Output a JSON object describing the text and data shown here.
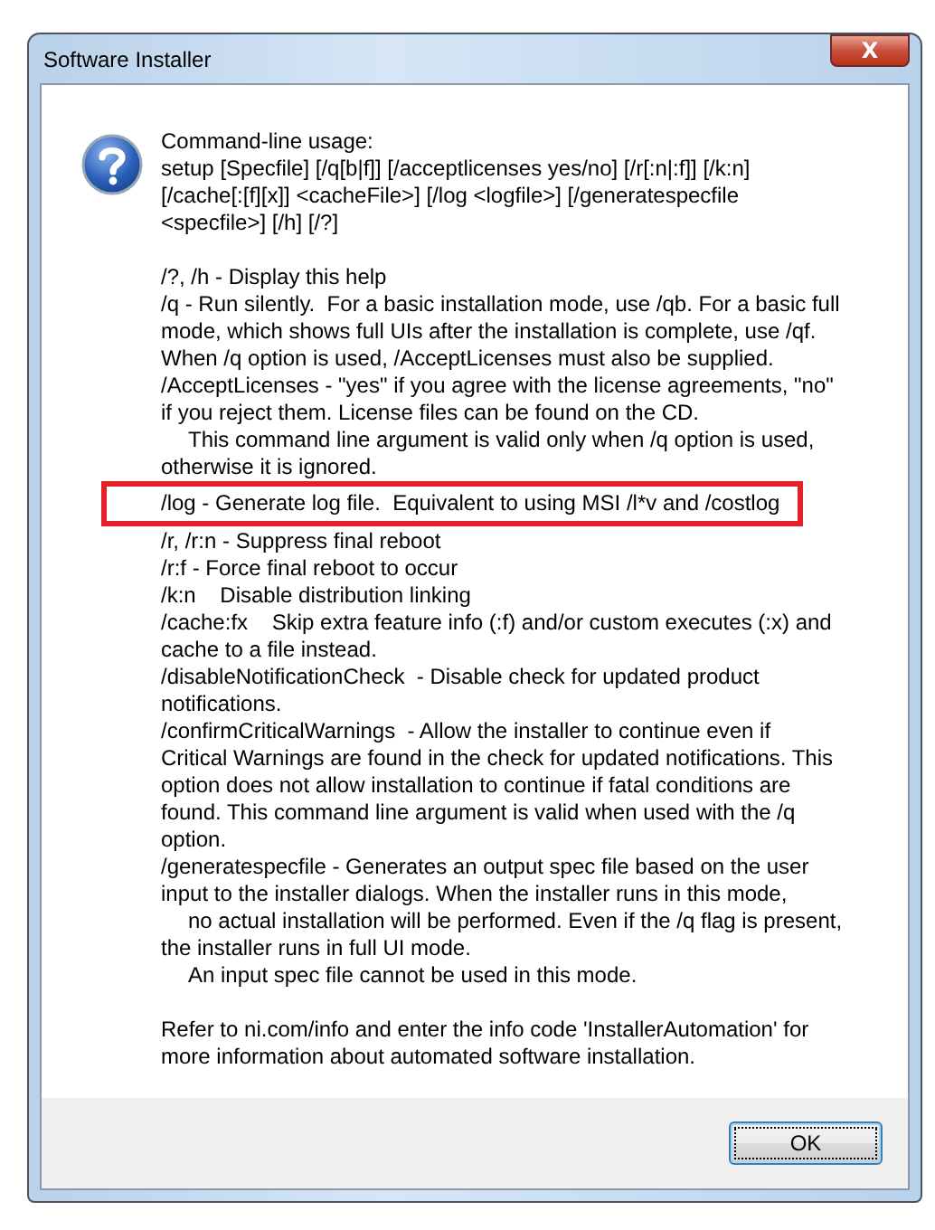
{
  "window": {
    "title": "Software Installer",
    "close_label": "X"
  },
  "message": {
    "paragraphs": [
      [
        {
          "text": "Command-line usage:",
          "indent": false
        },
        {
          "text": "setup [Specfile] [/q[b|f]] [/acceptlicenses yes/no] [/r[:n|:f]] [/k:n]",
          "indent": false
        },
        {
          "text": "[/cache[:[f][x]] <cacheFile>] [/log <logfile>] [/generatespecfile",
          "indent": false
        },
        {
          "text": "<specfile>] [/h] [/?]",
          "indent": false
        }
      ],
      [
        {
          "text": "/?, /h - Display this help",
          "indent": false
        },
        {
          "text": "/q - Run silently.  For a basic installation mode, use /qb. For a basic full",
          "indent": false
        },
        {
          "text": "mode, which shows full UIs after the installation is complete, use /qf.",
          "indent": false
        },
        {
          "text": "When /q option is used, /AcceptLicenses must also be supplied.",
          "indent": false
        },
        {
          "text": "/AcceptLicenses - \"yes\" if you agree with the license agreements, \"no\"",
          "indent": false
        },
        {
          "text": "if you reject them. License files can be found on the CD.",
          "indent": false
        },
        {
          "text": "This command line argument is valid only when /q option is used,",
          "indent": true
        },
        {
          "text": "otherwise it is ignored.",
          "indent": false
        },
        {
          "text": "/log - Generate log file.  Equivalent to using MSI /l*v and /costlog",
          "indent": false,
          "highlighted": true
        },
        {
          "text": "/r, /r:n - Suppress final reboot",
          "indent": false
        },
        {
          "text": "/r:f - Force final reboot to occur",
          "indent": false
        },
        {
          "text": "/k:n    Disable distribution linking",
          "indent": false
        },
        {
          "text": "/cache:fx    Skip extra feature info (:f) and/or custom executes (:x) and",
          "indent": false
        },
        {
          "text": "cache to a file instead.",
          "indent": false
        },
        {
          "text": "/disableNotificationCheck  - Disable check for updated product",
          "indent": false
        },
        {
          "text": "notifications.",
          "indent": false
        },
        {
          "text": "/confirmCriticalWarnings  - Allow the installer to continue even if",
          "indent": false
        },
        {
          "text": "Critical Warnings are found in the check for updated notifications. This",
          "indent": false
        },
        {
          "text": "option does not allow installation to continue if fatal conditions are",
          "indent": false
        },
        {
          "text": "found. This command line argument is valid when used with the /q",
          "indent": false
        },
        {
          "text": "option.",
          "indent": false
        },
        {
          "text": "/generatespecfile - Generates an output spec file based on the user",
          "indent": false
        },
        {
          "text": "input to the installer dialogs. When the installer runs in this mode,",
          "indent": false
        },
        {
          "text": "no actual installation will be performed. Even if the /q flag is present,",
          "indent": true
        },
        {
          "text": "the installer runs in full UI mode.",
          "indent": false
        },
        {
          "text": "An input spec file cannot be used in this mode.",
          "indent": true
        }
      ],
      [
        {
          "text": "Refer to ni.com/info and enter the info code 'InstallerAutomation' for",
          "indent": false
        },
        {
          "text": "more information about automated software installation.",
          "indent": false
        }
      ]
    ]
  },
  "buttons": [
    {
      "label": "OK",
      "focused": true
    }
  ]
}
